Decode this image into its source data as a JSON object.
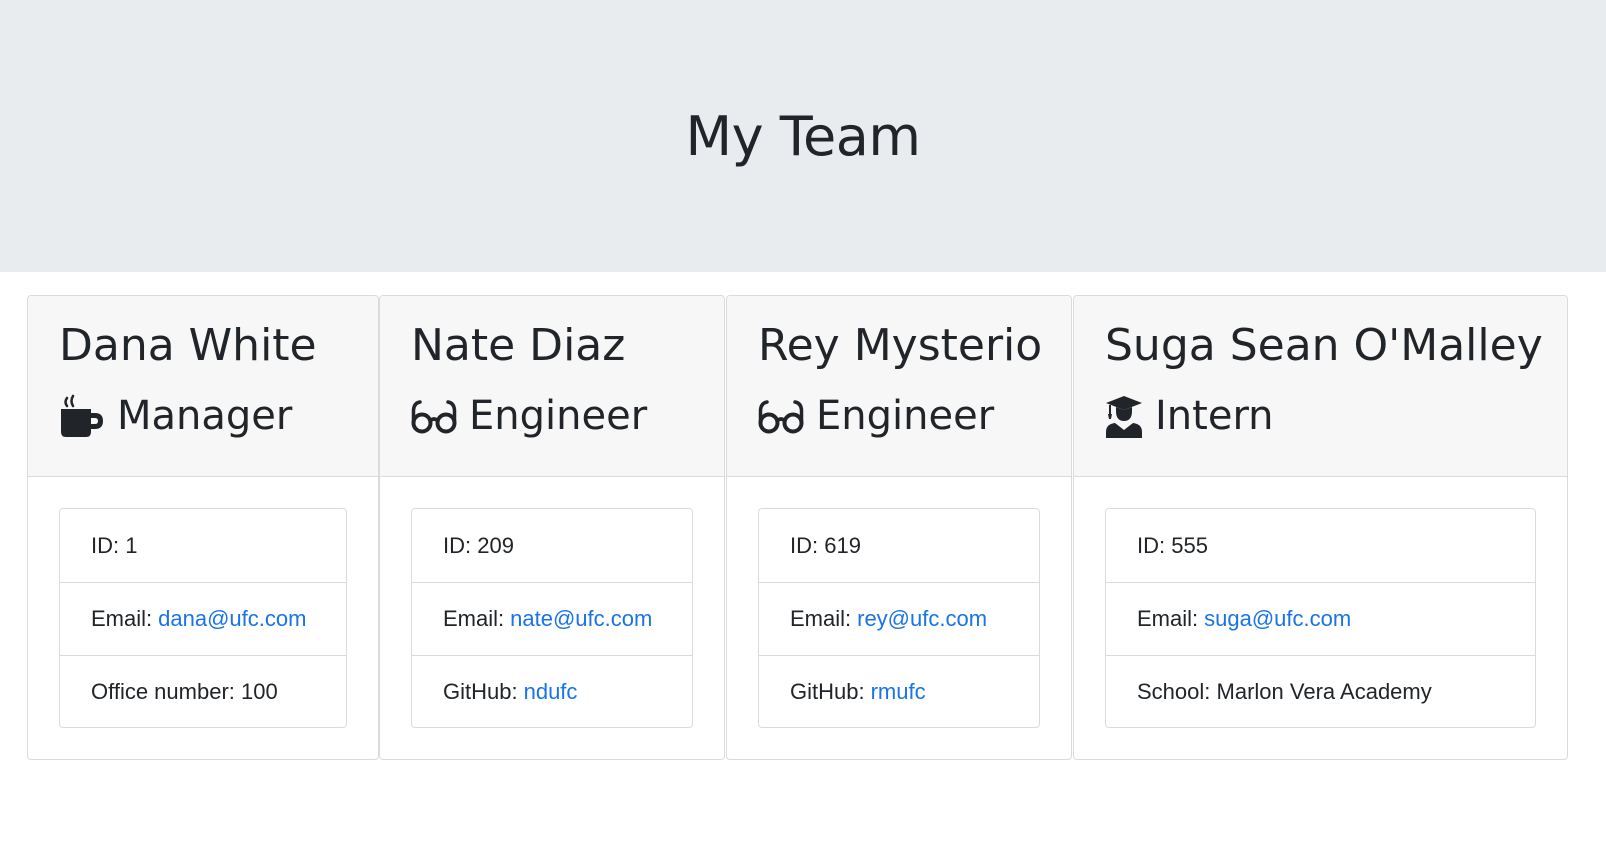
{
  "header": {
    "title": "My Team"
  },
  "team": [
    {
      "name": "Dana White",
      "role": "Manager",
      "role_icon": "mug-icon",
      "id_label": "ID:",
      "id": "1",
      "email_label": "Email:",
      "email": "dana@ufc.com",
      "extra_label": "Office number:",
      "extra": "100"
    },
    {
      "name": "Nate Diaz",
      "role": "Engineer",
      "role_icon": "glasses-icon",
      "id_label": "ID:",
      "id": "209",
      "email_label": "Email:",
      "email": "nate@ufc.com",
      "extra_label": "GitHub:",
      "extra": "ndufc"
    },
    {
      "name": "Rey Mysterio",
      "role": "Engineer",
      "role_icon": "glasses-icon",
      "id_label": "ID:",
      "id": "619",
      "email_label": "Email:",
      "email": "rey@ufc.com",
      "extra_label": "GitHub:",
      "extra": "rmufc"
    },
    {
      "name": "Suga Sean O'Malley",
      "role": "Intern",
      "role_icon": "graduate-icon",
      "id_label": "ID:",
      "id": "555",
      "email_label": "Email:",
      "email": "suga@ufc.com",
      "extra_label": "School:",
      "extra": "Marlon Vera Academy"
    }
  ],
  "colors": {
    "jumbotron_bg": "#e9ecef",
    "card_header_bg": "#f7f7f7",
    "link": "#1a73e8",
    "text": "#212529"
  }
}
